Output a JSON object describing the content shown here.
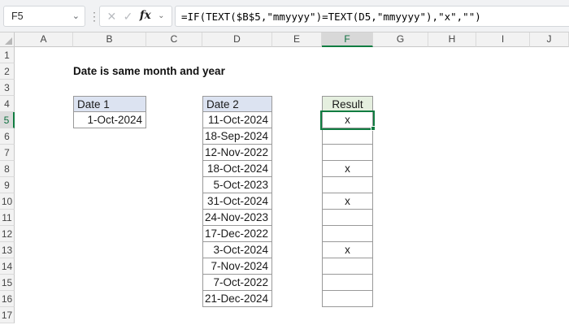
{
  "formula_bar": {
    "name_box_value": "F5",
    "name_dropdown_glyph": "⌄",
    "handle_glyph": "⋮",
    "cancel_label": "✕",
    "enter_label": "✓",
    "insert_function_label": "fx",
    "fx_dropdown_glyph": "⌄",
    "formula": "=IF(TEXT($B$5,\"mmyyyy\")=TEXT(D5,\"mmyyyy\"),\"x\",\"\")"
  },
  "sheet": {
    "title": "Date is same month and year",
    "columns": [
      "A",
      "B",
      "C",
      "D",
      "E",
      "F",
      "G",
      "H",
      "I",
      "J"
    ],
    "rows": [
      "1",
      "2",
      "3",
      "4",
      "5",
      "6",
      "7",
      "8",
      "9",
      "10",
      "11",
      "12",
      "13",
      "14",
      "15",
      "16",
      "17"
    ],
    "selection": {
      "cell": "F5",
      "column": "F",
      "row": "5"
    },
    "date1": {
      "header": "Date 1",
      "value": "1-Oct-2024"
    },
    "date2": {
      "header": "Date 2",
      "values": [
        "11-Oct-2024",
        "18-Sep-2024",
        "12-Nov-2022",
        "18-Oct-2024",
        "5-Oct-2023",
        "31-Oct-2024",
        "24-Nov-2023",
        "17-Dec-2022",
        "3-Oct-2024",
        "7-Nov-2024",
        "7-Oct-2022",
        "21-Dec-2024"
      ]
    },
    "result": {
      "header": "Result",
      "values": [
        "x",
        "",
        "",
        "x",
        "",
        "x",
        "",
        "",
        "x",
        "",
        "",
        ""
      ]
    }
  },
  "colors": {
    "accent_green": "#107c41",
    "selected_header_text": "#0c6e3d",
    "date_header_fill": "#dce3f1",
    "result_header_fill": "#e5efdf",
    "table_border": "#999999"
  }
}
